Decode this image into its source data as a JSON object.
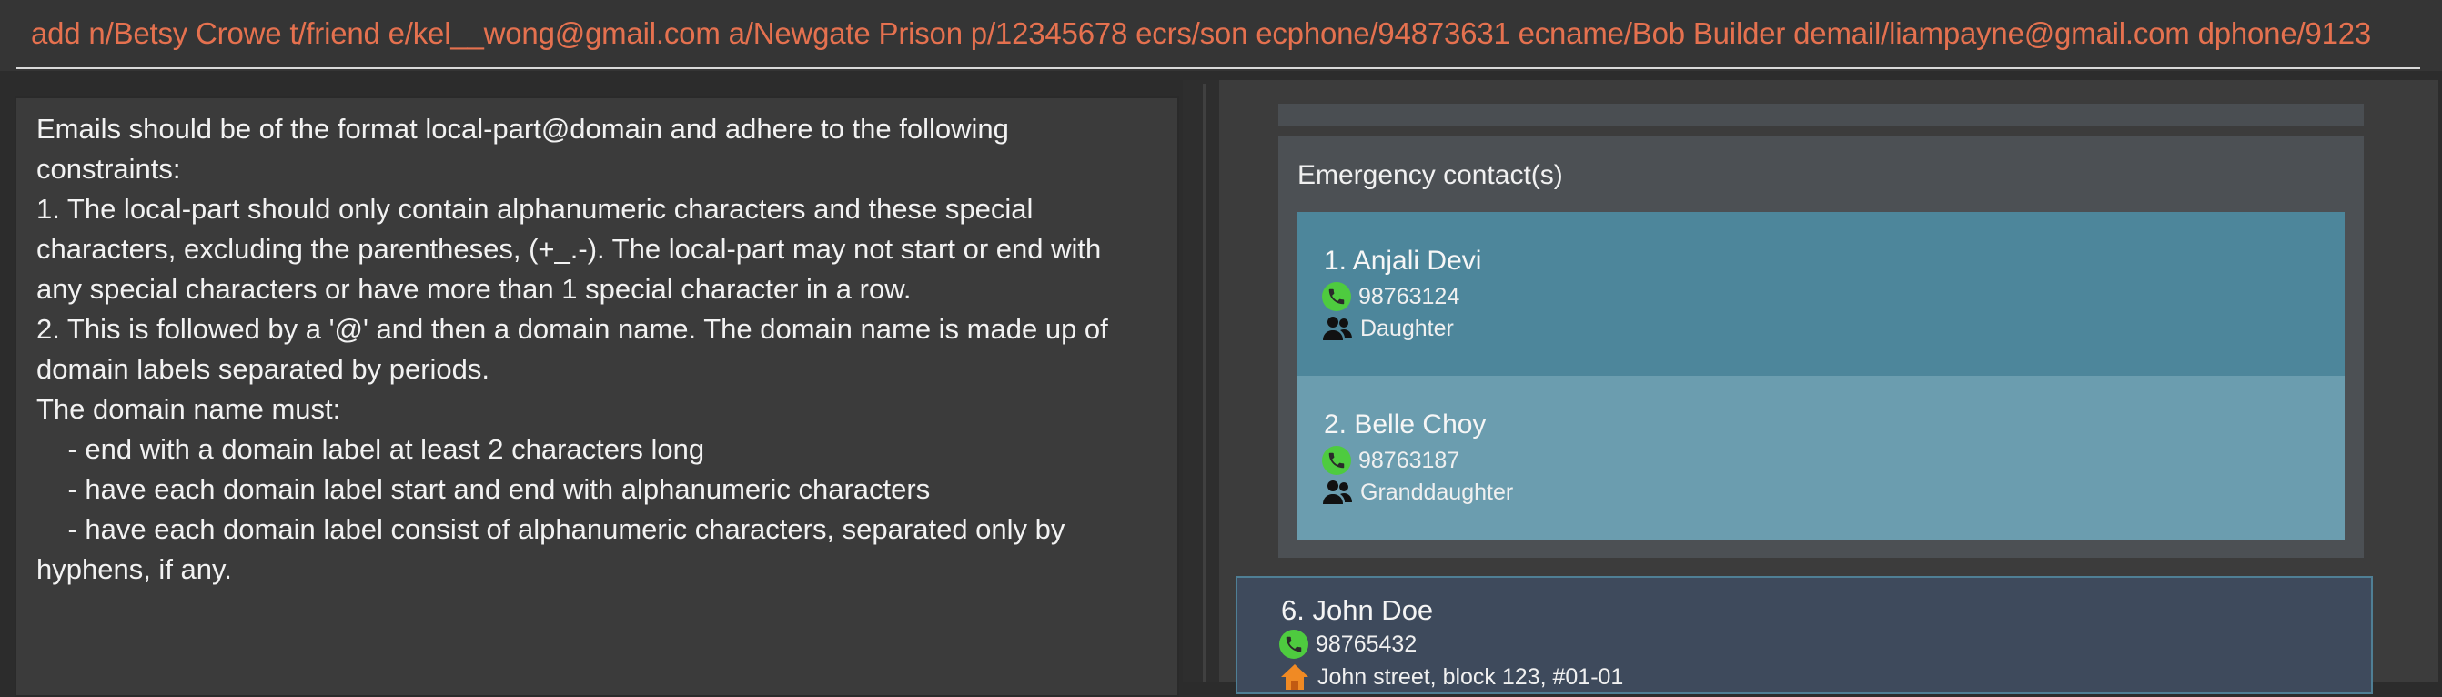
{
  "command": {
    "text": "add n/Betsy Crowe t/friend e/kel__wong@gmail.com a/Newgate Prison p/12345678 ecrs/son ecphone/94873631 ecname/Bob Builder demail/liampayne@gmail.com dphone/9123"
  },
  "result": {
    "text": "Emails should be of the format local-part@domain and adhere to the following\nconstraints:\n1. The local-part should only contain alphanumeric characters and these special\ncharacters, excluding the parentheses, (+_.-). The local-part may not start or end with\nany special characters or have more than 1 special character in a row.\n2. This is followed by a '@' and then a domain name. The domain name is made up of\ndomain labels separated by periods.\nThe domain name must:\n    - end with a domain label at least 2 characters long\n    - have each domain label start and end with alphanumeric characters\n    - have each domain label consist of alphanumeric characters, separated only by\nhyphens, if any."
  },
  "emergency_contacts": {
    "title": "Emergency contact(s)",
    "items": [
      {
        "name": "1. Anjali Devi",
        "phone": "98763124",
        "relationship": "Daughter"
      },
      {
        "name": "2. Belle Choy",
        "phone": "98763187",
        "relationship": "Granddaughter"
      }
    ]
  },
  "person": {
    "name": "6. John Doe",
    "phone": "98765432",
    "address": "John street, block 123, #01-01"
  },
  "colors": {
    "command_text": "#e5714f",
    "contact_primary": "#4d869b",
    "contact_secondary": "#6b9daf",
    "phone_icon": "#4ecb3f"
  },
  "icons": [
    "phone-icon",
    "people-icon",
    "house-icon"
  ]
}
